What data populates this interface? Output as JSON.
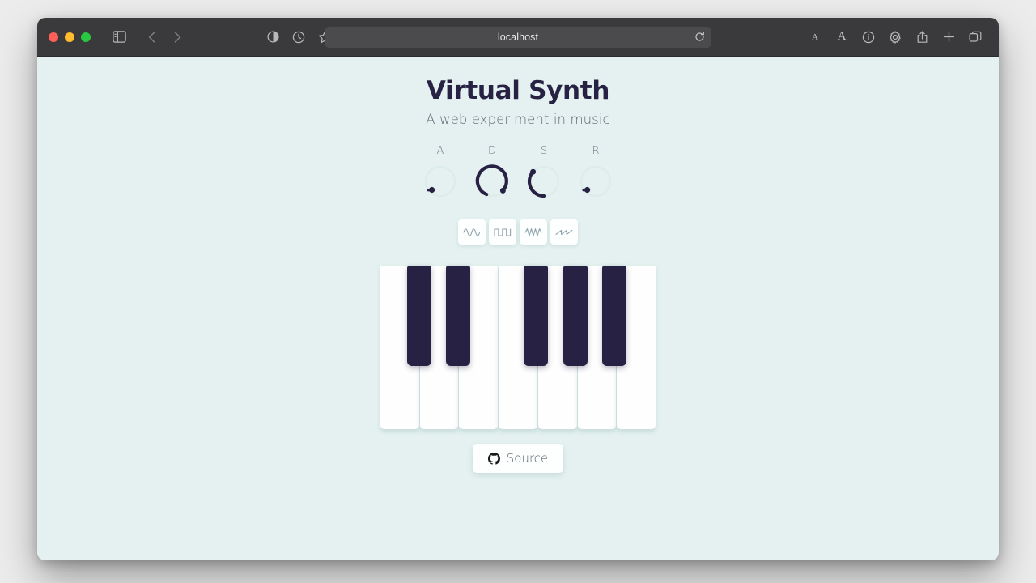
{
  "browser": {
    "url": "localhost",
    "traffic_lights": [
      "close",
      "minimize",
      "maximize"
    ],
    "left_icons": [
      "sidebar-icon",
      "back-icon",
      "forward-icon",
      "shield-icon",
      "history-icon",
      "bookmark-star-icon"
    ],
    "right_icons": [
      "reload-icon",
      "font-decrease-icon",
      "font-increase-icon",
      "info-icon",
      "settings-gear-icon",
      "share-icon",
      "new-tab-icon",
      "tab-overview-icon"
    ],
    "font_small_label": "A",
    "font_large_label": "A"
  },
  "app": {
    "title": "Virtual Synth",
    "subtitle": "A web experiment in music",
    "knobs": [
      {
        "label": "A",
        "icon": "knob-attack",
        "value_deg": 20,
        "active": false
      },
      {
        "label": "D",
        "icon": "knob-decay",
        "value_deg": 300,
        "active": true
      },
      {
        "label": "S",
        "icon": "knob-sustain",
        "value_deg": 130,
        "active": true
      },
      {
        "label": "R",
        "icon": "knob-release",
        "value_deg": 20,
        "active": false
      }
    ],
    "waveforms": [
      {
        "name": "sine",
        "icon": "sine-wave-icon"
      },
      {
        "name": "square",
        "icon": "square-wave-icon"
      },
      {
        "name": "triangle",
        "icon": "triangle-wave-icon"
      },
      {
        "name": "sawtooth",
        "icon": "sawtooth-wave-icon"
      }
    ],
    "piano": {
      "white_keys": [
        "C",
        "D",
        "E",
        "F",
        "G",
        "A",
        "B"
      ],
      "black_keys": [
        "C#",
        "D#",
        "F#",
        "G#",
        "A#"
      ],
      "black_key_offsets": [
        41,
        89,
        179,
        227,
        275
      ]
    },
    "source_button": {
      "label": "Source",
      "icon": "github-icon"
    },
    "colors": {
      "background": "#e4f1f0",
      "ink": "#272244",
      "muted": "#5d6b74",
      "key_white": "#fefefe",
      "key_black": "#272244"
    }
  }
}
